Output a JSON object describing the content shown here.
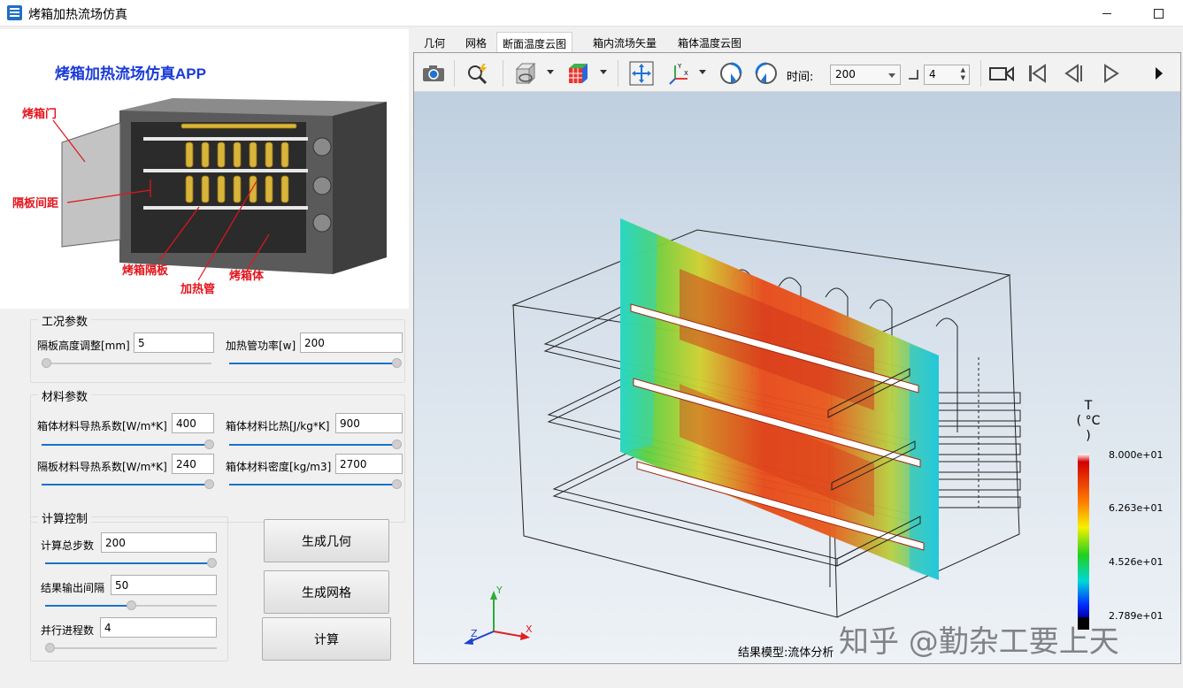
{
  "window": {
    "title": "烤箱加热流场仿真"
  },
  "schematic": {
    "app_title": "烤箱加热流场仿真APP",
    "labels": {
      "door": "烤箱门",
      "spacing": "隔板间距",
      "shelf": "烤箱隔板",
      "heater": "加热管",
      "body": "烤箱体"
    }
  },
  "operating": {
    "title": "工况参数",
    "shelf_height": {
      "label": "隔板高度调整[mm]",
      "value": "5",
      "slider": 0.0
    },
    "heater_power": {
      "label": "加热管功率[w]",
      "value": "200",
      "slider": 1.0
    }
  },
  "material": {
    "title": "材料参数",
    "body_conductivity": {
      "label": "箱体材料导热系数[W/m*K]",
      "value": "400",
      "slider": 1.0
    },
    "body_specific_heat": {
      "label": "箱体材料比热[J/kg*K]",
      "value": "900",
      "slider": 1.0
    },
    "shelf_conductivity": {
      "label": "隔板材料导热系数[W/m*K]",
      "value": "240",
      "slider": 1.0
    },
    "body_density": {
      "label": "箱体材料密度[kg/m3]",
      "value": "2700",
      "slider": 1.0
    }
  },
  "compute": {
    "title": "计算控制",
    "total_steps": {
      "label": "计算总步数",
      "value": "200",
      "slider": 1.0
    },
    "output_interval": {
      "label": "结果输出间隔",
      "value": "50",
      "slider": 0.5
    },
    "processes": {
      "label": "并行进程数",
      "value": "4",
      "slider": 0.0
    }
  },
  "buttons": {
    "gen_geometry": "生成几何",
    "gen_mesh": "生成网格",
    "compute": "计算"
  },
  "tabs": [
    "几何",
    "网格",
    "断面温度云图",
    "箱内流场矢量",
    "箱体温度云图"
  ],
  "active_tab": 2,
  "toolbar": {
    "time_label": "时间:",
    "time_value": "200",
    "step_value": "4"
  },
  "viewer": {
    "legend_title_1": "T",
    "legend_title_2": "( °C )",
    "legend_values": [
      "8.000e+01",
      "6.263e+01",
      "4.526e+01",
      "2.789e+01"
    ],
    "axes": {
      "x": "X",
      "y": "Y",
      "z": "Z"
    },
    "result_caption": "结果模型:流体分析",
    "watermark": "知乎 @勤杂工要上天"
  },
  "icons": [
    "camera-icon",
    "probe-icon",
    "view-cube-icon",
    "color-cube-icon",
    "fit-view-icon",
    "axes-orient-icon",
    "rotate-left-icon",
    "rotate-right-icon",
    "record-icon",
    "first-frame-icon",
    "prev-frame-icon",
    "play-icon",
    "more-icon"
  ]
}
